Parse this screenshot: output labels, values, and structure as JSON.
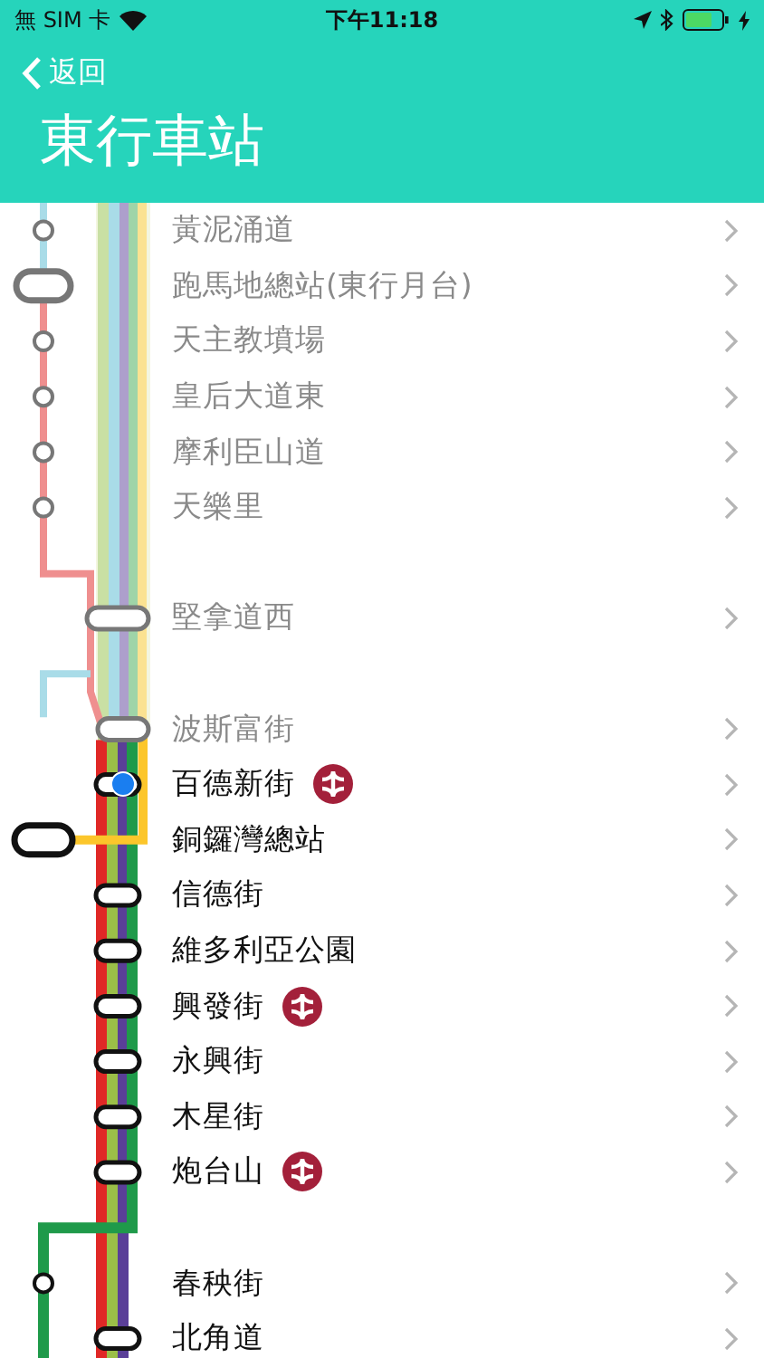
{
  "status_bar": {
    "carrier": "無 SIM 卡",
    "time": "下午11:18"
  },
  "nav": {
    "back": "返回",
    "title": "東行車站"
  },
  "stations": [
    {
      "name": "黃泥涌道",
      "passed": true,
      "current": false,
      "mtr": false,
      "gap_before": false
    },
    {
      "name": "跑馬地總站(東行月台)",
      "passed": true,
      "current": false,
      "mtr": false,
      "gap_before": false
    },
    {
      "name": "天主教墳場",
      "passed": true,
      "current": false,
      "mtr": false,
      "gap_before": false
    },
    {
      "name": "皇后大道東",
      "passed": true,
      "current": false,
      "mtr": false,
      "gap_before": false
    },
    {
      "name": "摩利臣山道",
      "passed": true,
      "current": false,
      "mtr": false,
      "gap_before": false
    },
    {
      "name": "天樂里",
      "passed": true,
      "current": false,
      "mtr": false,
      "gap_before": false
    },
    {
      "name": "堅拿道西",
      "passed": true,
      "current": false,
      "mtr": false,
      "gap_before": true
    },
    {
      "name": "波斯富街",
      "passed": true,
      "current": false,
      "mtr": false,
      "gap_before": true
    },
    {
      "name": "百德新街",
      "passed": false,
      "current": true,
      "mtr": true,
      "gap_before": false
    },
    {
      "name": "銅鑼灣總站",
      "passed": false,
      "current": false,
      "mtr": false,
      "gap_before": false
    },
    {
      "name": "信德街",
      "passed": false,
      "current": false,
      "mtr": false,
      "gap_before": false
    },
    {
      "name": "維多利亞公園",
      "passed": false,
      "current": false,
      "mtr": false,
      "gap_before": false
    },
    {
      "name": "興發街",
      "passed": false,
      "current": false,
      "mtr": true,
      "gap_before": false
    },
    {
      "name": "永興街",
      "passed": false,
      "current": false,
      "mtr": false,
      "gap_before": false
    },
    {
      "name": "木星街",
      "passed": false,
      "current": false,
      "mtr": false,
      "gap_before": false
    },
    {
      "name": "炮台山",
      "passed": false,
      "current": false,
      "mtr": true,
      "gap_before": false
    },
    {
      "name": "春秧街",
      "passed": false,
      "current": false,
      "mtr": false,
      "gap_before": true
    },
    {
      "name": "北角道",
      "passed": false,
      "current": false,
      "mtr": false,
      "gap_before": false
    }
  ]
}
